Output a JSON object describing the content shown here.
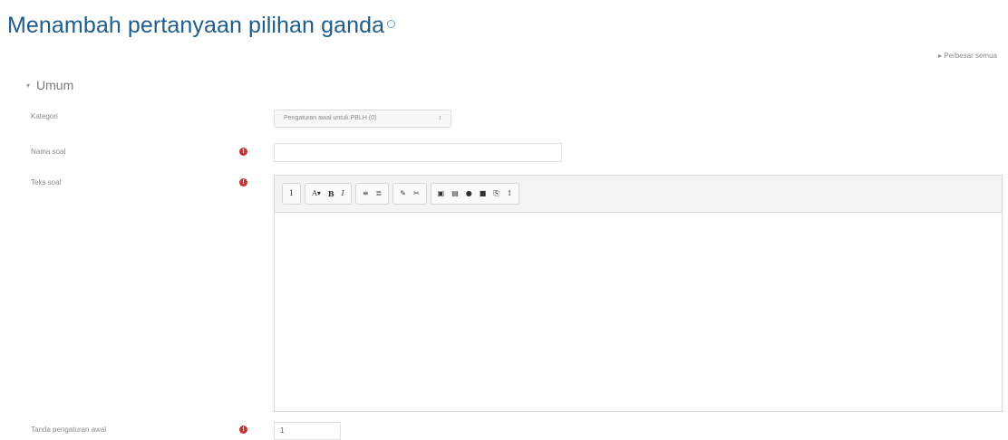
{
  "page": {
    "title": "Menambah pertanyaan pilihan ganda",
    "expand_all": "▸ Perbesar semua"
  },
  "section": {
    "toggle": "▾",
    "title": "Umum"
  },
  "fields": {
    "category_label": "Kategori",
    "category_value": "Pengaturan awal untuk PBLH (0)",
    "question_name_label": "Nama soal",
    "question_name_value": "",
    "question_text_label": "Teks soal",
    "default_mark_label": "Tanda pengaturan awal",
    "default_mark_value": "1"
  },
  "required_marker": "!",
  "toolbar": {
    "groups": [
      [
        "1"
      ],
      [
        "A▾",
        "B",
        "I"
      ],
      [
        "≡",
        "≣"
      ],
      [
        "✎",
        "✂"
      ],
      [
        "▣",
        "▤",
        "●",
        "■",
        "⎘",
        "↕"
      ]
    ]
  },
  "icons": {
    "help": "help-icon",
    "required": "required-icon",
    "select_caret": "↕"
  },
  "colors": {
    "title": "#1f5d8a",
    "required": "#cc3333"
  }
}
